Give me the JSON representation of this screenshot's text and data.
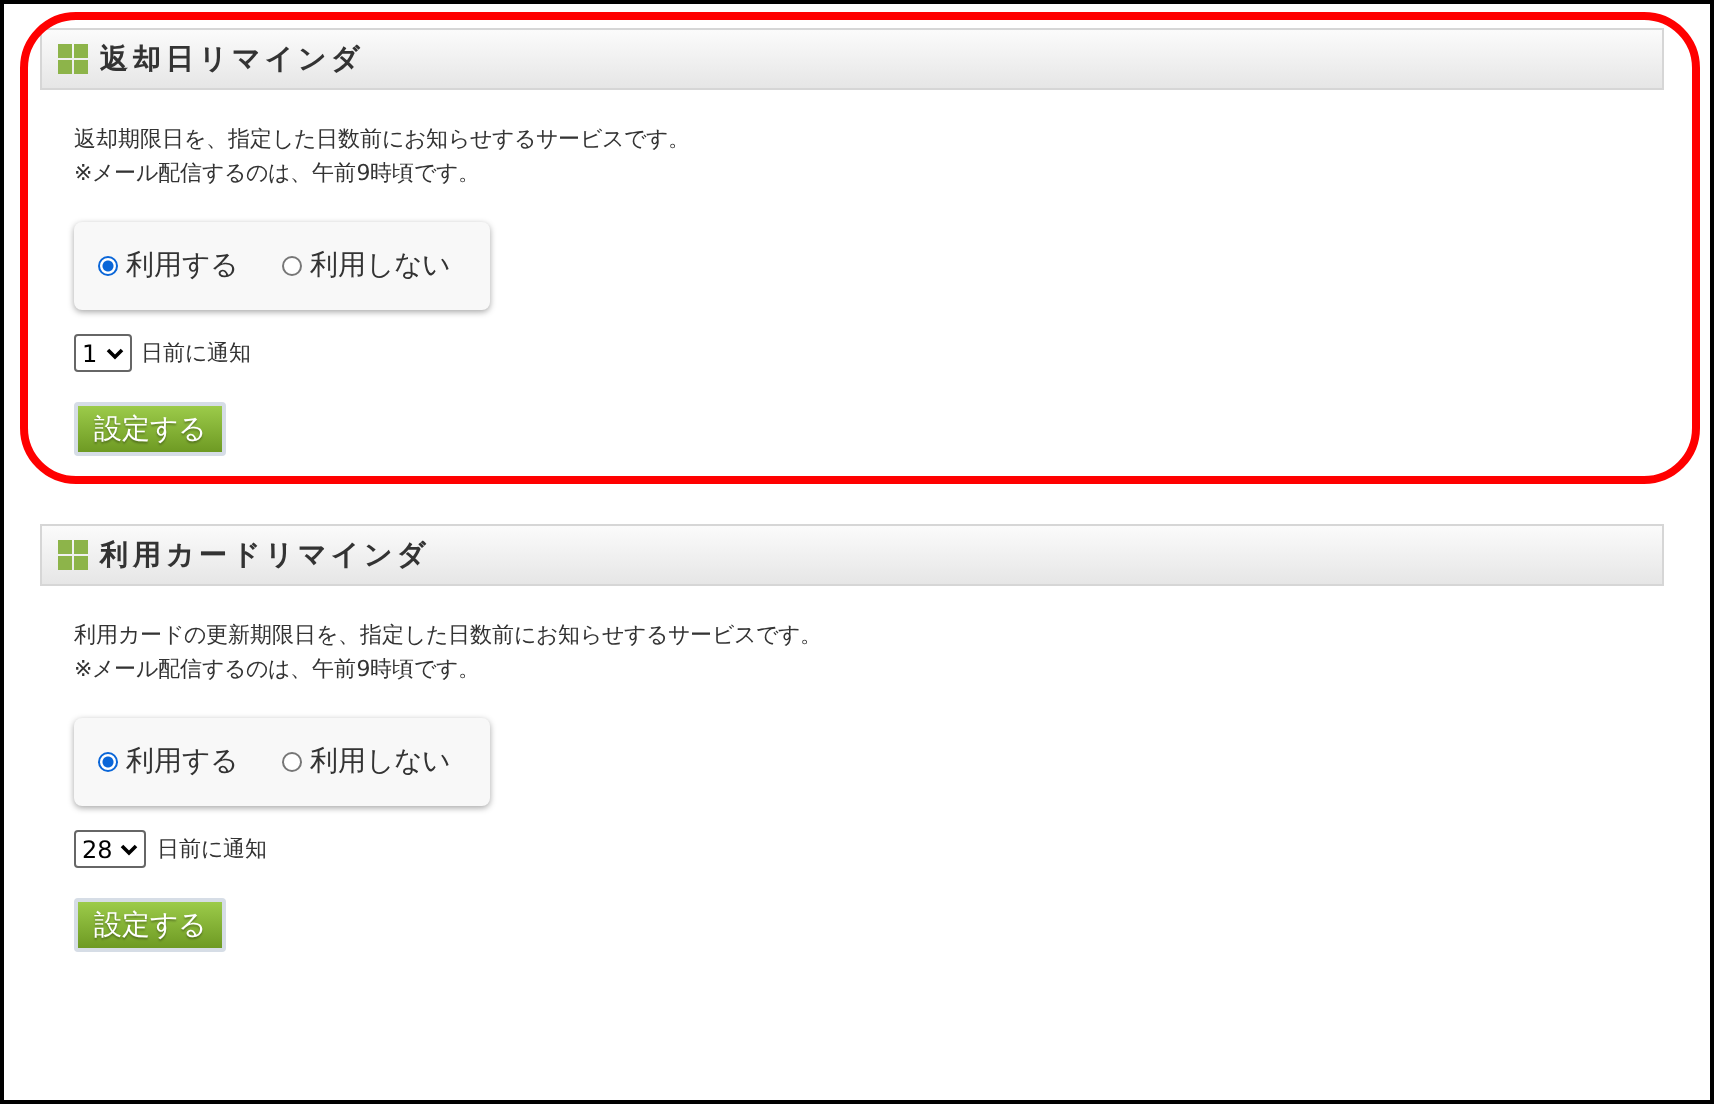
{
  "sections": [
    {
      "title": "返却日リマインダ",
      "highlighted": true,
      "description": [
        "返却期限日を、指定した日数前にお知らせするサービスです。",
        "※メール配信するのは、午前9時頃です。"
      ],
      "options": [
        {
          "label": "利用する",
          "selected": true
        },
        {
          "label": "利用しない",
          "selected": false
        }
      ],
      "days": "1",
      "days_suffix": "日前に通知",
      "button": "設定する"
    },
    {
      "title": "利用カードリマインダ",
      "highlighted": false,
      "description": [
        "利用カードの更新期限日を、指定した日数前にお知らせするサービスです。",
        "※メール配信するのは、午前9時頃です。"
      ],
      "options": [
        {
          "label": "利用する",
          "selected": true
        },
        {
          "label": "利用しない",
          "selected": false
        }
      ],
      "days": "28",
      "days_suffix": "日前に通知",
      "button": "設定する"
    }
  ]
}
